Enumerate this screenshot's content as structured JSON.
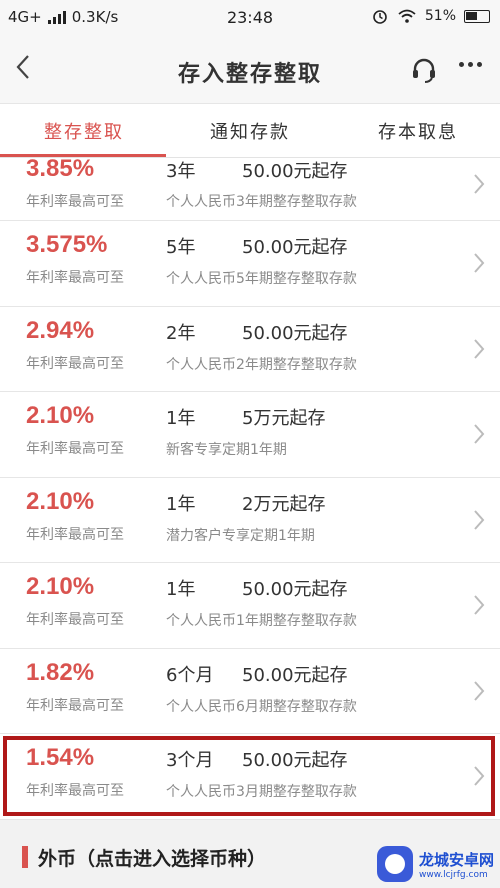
{
  "status": {
    "network": "4G+",
    "speed": "0.3K/s",
    "time": "23:48",
    "battery": "51%"
  },
  "nav": {
    "title": "存入整存整取"
  },
  "tabs": [
    "整存整取",
    "通知存款",
    "存本取息"
  ],
  "rows": [
    {
      "rate": "3.85%",
      "rate_label": "年利率最高可至",
      "term": "3年",
      "amount": "50.00元起存",
      "desc": "个人人民币3年期整存整取存款"
    },
    {
      "rate": "3.575%",
      "rate_label": "年利率最高可至",
      "term": "5年",
      "amount": "50.00元起存",
      "desc": "个人人民币5年期整存整取存款"
    },
    {
      "rate": "2.94%",
      "rate_label": "年利率最高可至",
      "term": "2年",
      "amount": "50.00元起存",
      "desc": "个人人民币2年期整存整取存款"
    },
    {
      "rate": "2.10%",
      "rate_label": "年利率最高可至",
      "term": "1年",
      "amount": "5万元起存",
      "desc": "新客专享定期1年期"
    },
    {
      "rate": "2.10%",
      "rate_label": "年利率最高可至",
      "term": "1年",
      "amount": "2万元起存",
      "desc": "潜力客户专享定期1年期"
    },
    {
      "rate": "2.10%",
      "rate_label": "年利率最高可至",
      "term": "1年",
      "amount": "50.00元起存",
      "desc": "个人人民币1年期整存整取存款"
    },
    {
      "rate": "1.82%",
      "rate_label": "年利率最高可至",
      "term": "6个月",
      "amount": "50.00元起存",
      "desc": "个人人民币6月期整存整取存款"
    },
    {
      "rate": "1.54%",
      "rate_label": "年利率最高可至",
      "term": "3个月",
      "amount": "50.00元起存",
      "desc": "个人人民币3月期整存整取存款"
    }
  ],
  "forex": {
    "label": "外币（点击进入选择币种）"
  },
  "watermark": {
    "name": "龙城安卓网",
    "url": "www.lcjrfg.com"
  },
  "colors": {
    "accent": "#d9534f",
    "highlight_border": "#b01818"
  }
}
